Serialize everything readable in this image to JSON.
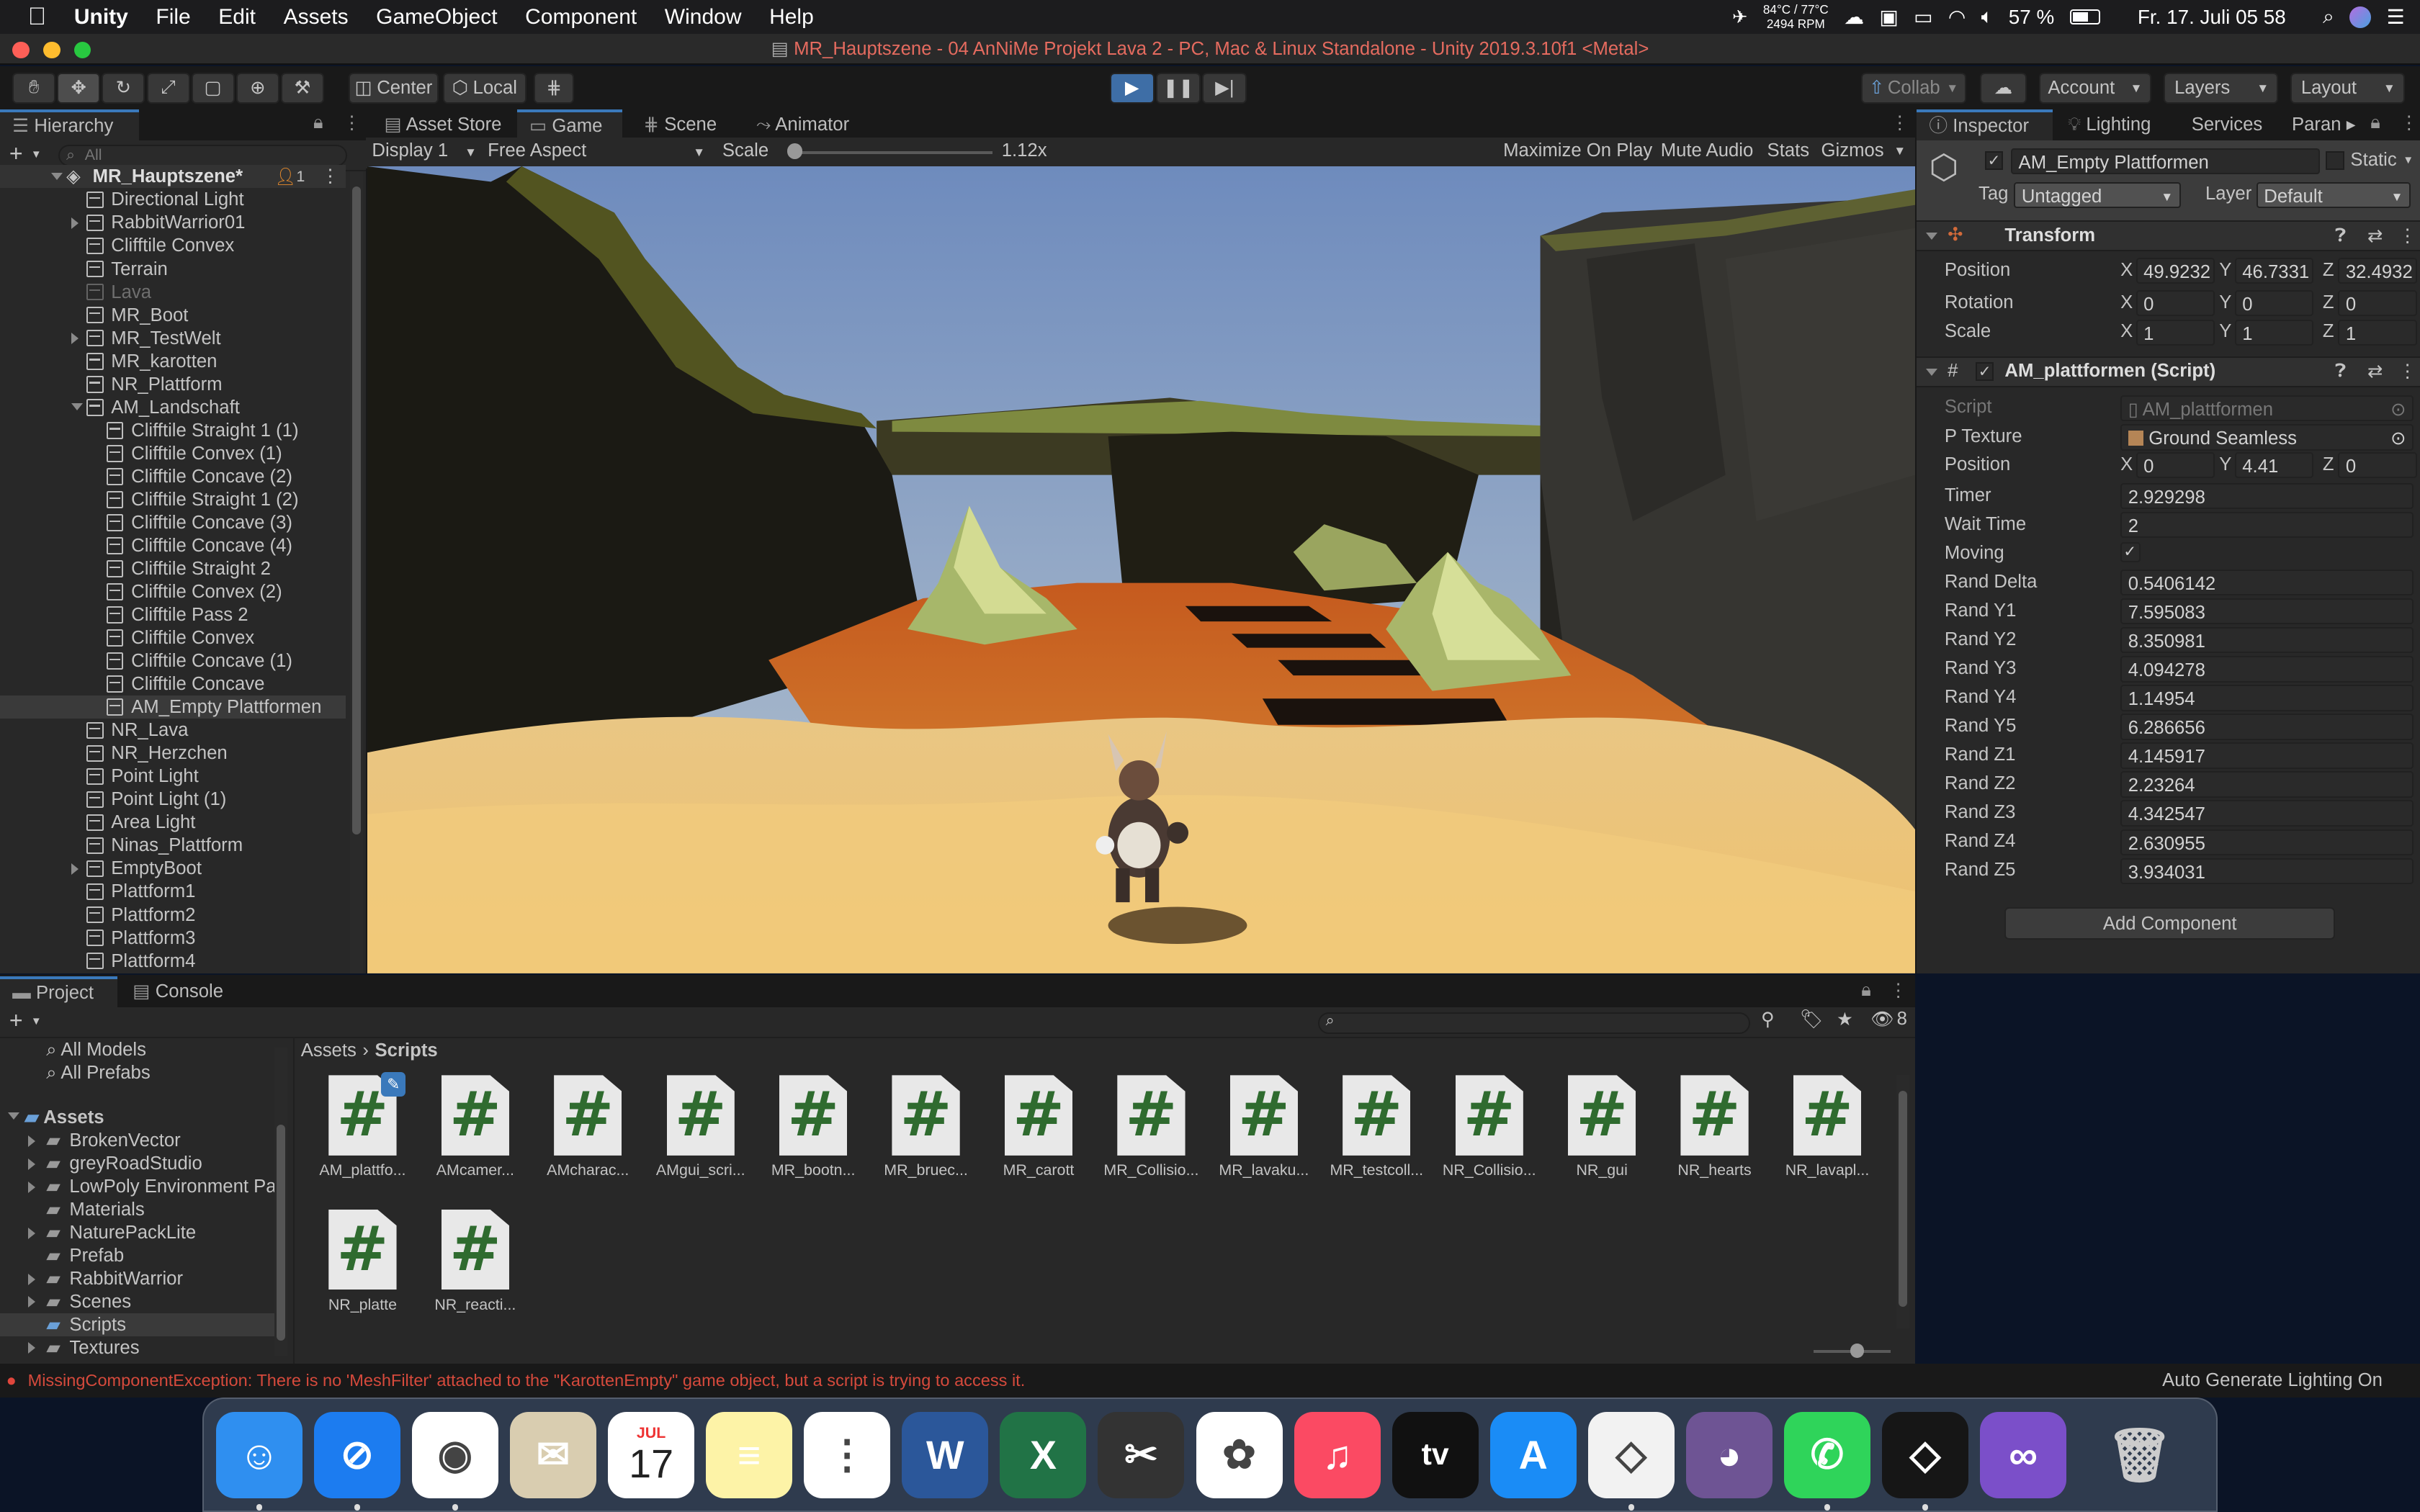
{
  "menubar": {
    "app": "Unity",
    "items": [
      "File",
      "Edit",
      "Assets",
      "GameObject",
      "Component",
      "Window",
      "Help"
    ],
    "temp": "84°C / 77°C",
    "rpm": "2494 RPM",
    "battery": "57 %",
    "datetime": "Fr. 17. Juli  05 58"
  },
  "window": {
    "title": "MR_Hauptszene - 04 AnNiMe Projekt Lava 2 - PC, Mac & Linux Standalone - Unity 2019.3.10f1 <Metal>"
  },
  "toolbar": {
    "center": "Center",
    "local": "Local",
    "collab": "Collab",
    "account": "Account",
    "layers": "Layers",
    "layout": "Layout"
  },
  "hierarchy": {
    "tab": "Hierarchy",
    "search_placeholder": "All",
    "scene": "MR_Hauptszene*",
    "scene_badge": "1",
    "items": [
      {
        "label": "Directional Light",
        "indent": 1,
        "expander": false,
        "dim": false,
        "selected": false
      },
      {
        "label": "RabbitWarrior01",
        "indent": 1,
        "expander": true,
        "dim": false,
        "selected": false
      },
      {
        "label": "Clifftile Convex",
        "indent": 1,
        "expander": false,
        "dim": false,
        "selected": false
      },
      {
        "label": "Terrain",
        "indent": 1,
        "expander": false,
        "dim": false,
        "selected": false
      },
      {
        "label": "Lava",
        "indent": 1,
        "expander": false,
        "dim": true,
        "selected": false
      },
      {
        "label": "MR_Boot",
        "indent": 1,
        "expander": false,
        "dim": false,
        "selected": false
      },
      {
        "label": "MR_TestWelt",
        "indent": 1,
        "expander": true,
        "dim": false,
        "selected": false
      },
      {
        "label": "MR_karotten",
        "indent": 1,
        "expander": false,
        "dim": false,
        "selected": false
      },
      {
        "label": "NR_Plattform",
        "indent": 1,
        "expander": false,
        "dim": false,
        "selected": false
      },
      {
        "label": "AM_Landschaft",
        "indent": 1,
        "expander": "open",
        "dim": false,
        "selected": false
      },
      {
        "label": "Clifftile Straight 1 (1)",
        "indent": 2,
        "expander": false,
        "dim": false,
        "selected": false
      },
      {
        "label": "Clifftile Convex (1)",
        "indent": 2,
        "expander": false,
        "dim": false,
        "selected": false
      },
      {
        "label": "Clifftile Concave (2)",
        "indent": 2,
        "expander": false,
        "dim": false,
        "selected": false
      },
      {
        "label": "Clifftile Straight 1 (2)",
        "indent": 2,
        "expander": false,
        "dim": false,
        "selected": false
      },
      {
        "label": "Clifftile Concave (3)",
        "indent": 2,
        "expander": false,
        "dim": false,
        "selected": false
      },
      {
        "label": "Clifftile Concave (4)",
        "indent": 2,
        "expander": false,
        "dim": false,
        "selected": false
      },
      {
        "label": "Clifftile Straight 2",
        "indent": 2,
        "expander": false,
        "dim": false,
        "selected": false
      },
      {
        "label": "Clifftile Convex (2)",
        "indent": 2,
        "expander": false,
        "dim": false,
        "selected": false
      },
      {
        "label": "Clifftile Pass 2",
        "indent": 2,
        "expander": false,
        "dim": false,
        "selected": false
      },
      {
        "label": "Clifftile Convex",
        "indent": 2,
        "expander": false,
        "dim": false,
        "selected": false
      },
      {
        "label": "Clifftile Concave (1)",
        "indent": 2,
        "expander": false,
        "dim": false,
        "selected": false
      },
      {
        "label": "Clifftile Concave",
        "indent": 2,
        "expander": false,
        "dim": false,
        "selected": false
      },
      {
        "label": "AM_Empty Plattformen",
        "indent": 2,
        "expander": false,
        "dim": false,
        "selected": true
      },
      {
        "label": "NR_Lava",
        "indent": 1,
        "expander": false,
        "dim": false,
        "selected": false
      },
      {
        "label": "NR_Herzchen",
        "indent": 1,
        "expander": false,
        "dim": false,
        "selected": false
      },
      {
        "label": "Point Light",
        "indent": 1,
        "expander": false,
        "dim": false,
        "selected": false
      },
      {
        "label": "Point Light (1)",
        "indent": 1,
        "expander": false,
        "dim": false,
        "selected": false
      },
      {
        "label": "Area Light",
        "indent": 1,
        "expander": false,
        "dim": false,
        "selected": false
      },
      {
        "label": "Ninas_Plattform",
        "indent": 1,
        "expander": false,
        "dim": false,
        "selected": false
      },
      {
        "label": "EmptyBoot",
        "indent": 1,
        "expander": true,
        "dim": false,
        "selected": false
      },
      {
        "label": "Plattform1",
        "indent": 1,
        "expander": false,
        "dim": false,
        "selected": false
      },
      {
        "label": "Plattform2",
        "indent": 1,
        "expander": false,
        "dim": false,
        "selected": false
      },
      {
        "label": "Plattform3",
        "indent": 1,
        "expander": false,
        "dim": false,
        "selected": false
      },
      {
        "label": "Plattform4",
        "indent": 1,
        "expander": false,
        "dim": false,
        "selected": false
      }
    ]
  },
  "center": {
    "tabs": [
      "Asset Store",
      "Game",
      "Scene",
      "Animator"
    ],
    "display": "Display 1",
    "aspect": "Free Aspect",
    "scale_label": "Scale",
    "scale_value": "1.12x",
    "maximize": "Maximize On Play",
    "mute": "Mute Audio",
    "stats": "Stats",
    "gizmos": "Gizmos"
  },
  "inspector": {
    "tabs": [
      "Inspector",
      "Lighting",
      "Services",
      "Paran"
    ],
    "object_name": "AM_Empty Plattformen",
    "static": "Static",
    "tag_label": "Tag",
    "tag": "Untagged",
    "layer_label": "Layer",
    "layer": "Default",
    "transform": {
      "title": "Transform",
      "position": {
        "label": "Position",
        "x": "49.9232",
        "y": "46.7331",
        "z": "32.4932"
      },
      "rotation": {
        "label": "Rotation",
        "x": "0",
        "y": "0",
        "z": "0"
      },
      "scale": {
        "label": "Scale",
        "x": "1",
        "y": "1",
        "z": "1"
      }
    },
    "script": {
      "title": "AM_plattformen (Script)",
      "script_label": "Script",
      "script_value": "AM_plattformen",
      "texture_label": "P Texture",
      "texture_value": "Ground Seamless",
      "position": {
        "label": "Position",
        "x": "0",
        "y": "4.41",
        "z": "0"
      },
      "fields": [
        {
          "label": "Timer",
          "value": "2.929298"
        },
        {
          "label": "Wait Time",
          "value": "2"
        },
        {
          "label": "Moving",
          "value": "✓"
        },
        {
          "label": "Rand Delta",
          "value": "0.5406142"
        },
        {
          "label": "Rand Y1",
          "value": "7.595083"
        },
        {
          "label": "Rand Y2",
          "value": "8.350981"
        },
        {
          "label": "Rand Y3",
          "value": "4.094278"
        },
        {
          "label": "Rand Y4",
          "value": "1.14954"
        },
        {
          "label": "Rand Y5",
          "value": "6.286656"
        },
        {
          "label": "Rand Z1",
          "value": "4.145917"
        },
        {
          "label": "Rand Z2",
          "value": "2.23264"
        },
        {
          "label": "Rand Z3",
          "value": "4.342547"
        },
        {
          "label": "Rand Z4",
          "value": "2.630955"
        },
        {
          "label": "Rand Z5",
          "value": "3.934031"
        }
      ]
    },
    "add_component": "Add Component"
  },
  "project": {
    "tabs": [
      "Project",
      "Console"
    ],
    "hidden_count": "8",
    "breadcrumb_root": "Assets",
    "breadcrumb_current": "Scripts",
    "favorites": [
      "All Models",
      "All Prefabs"
    ],
    "assets_root": "Assets",
    "folders": [
      {
        "label": "BrokenVector",
        "expander": true,
        "selected": false
      },
      {
        "label": "greyRoadStudio",
        "expander": true,
        "selected": false
      },
      {
        "label": "LowPoly Environment Pa",
        "expander": true,
        "selected": false
      },
      {
        "label": "Materials",
        "expander": false,
        "selected": false
      },
      {
        "label": "NaturePackLite",
        "expander": true,
        "selected": false
      },
      {
        "label": "Prefab",
        "expander": false,
        "selected": false
      },
      {
        "label": "RabbitWarrior",
        "expander": true,
        "selected": false
      },
      {
        "label": "Scenes",
        "expander": true,
        "selected": false
      },
      {
        "label": "Scripts",
        "expander": false,
        "selected": true
      },
      {
        "label": "Textures",
        "expander": true,
        "selected": false
      }
    ],
    "scripts": [
      "AM_plattfo...",
      "AMcamer...",
      "AMcharac...",
      "AMgui_scri...",
      "MR_bootn...",
      "MR_bruec...",
      "MR_carott",
      "MR_Collisio...",
      "MR_lavaku...",
      "MR_testcoll...",
      "NR_Collisio...",
      "NR_gui",
      "NR_hearts",
      "NR_lavapl...",
      "NR_platte",
      "NR_reacti..."
    ]
  },
  "status": {
    "error": "MissingComponentException: There is no 'MeshFilter' attached to the \"KarottenEmpty\" game object, but a script is trying to access it.",
    "right": "Auto Generate Lighting On"
  },
  "dock": {
    "calendar_month": "JUL",
    "calendar_day": "17",
    "tv": "tv",
    "apps": [
      {
        "icon": "finder-icon",
        "bg": "#2f8ff0",
        "running": true
      },
      {
        "icon": "safari-icon",
        "bg": "#1c7cf0",
        "running": true
      },
      {
        "icon": "chrome-icon",
        "bg": "#ffffff",
        "running": true
      },
      {
        "icon": "mail-icon",
        "bg": "#d9cdb0",
        "running": false
      },
      {
        "icon": "calendar-icon",
        "bg": "#ffffff",
        "running": false
      },
      {
        "icon": "notes-icon",
        "bg": "#fdf3a7",
        "running": false
      },
      {
        "icon": "reminders-icon",
        "bg": "#ffffff",
        "running": false
      },
      {
        "icon": "word-icon",
        "bg": "#2b579a",
        "running": false
      },
      {
        "icon": "excel-icon",
        "bg": "#217346",
        "running": false
      },
      {
        "icon": "finalcut-icon",
        "bg": "#333333",
        "running": false
      },
      {
        "icon": "photos-icon",
        "bg": "#ffffff",
        "running": false
      },
      {
        "icon": "music-icon",
        "bg": "#fb4a63",
        "running": false
      },
      {
        "icon": "appletv-icon",
        "bg": "#111111",
        "running": false
      },
      {
        "icon": "appstore-icon",
        "bg": "#1a8cf6",
        "running": false
      },
      {
        "icon": "unity-hub-icon",
        "bg": "#f2f2f2",
        "running": true
      },
      {
        "icon": "github-icon",
        "bg": "#6e5494",
        "running": false
      },
      {
        "icon": "whatsapp-icon",
        "bg": "#2fd45a",
        "running": true
      },
      {
        "icon": "unity-icon",
        "bg": "#161616",
        "running": true
      },
      {
        "icon": "visualstudio-icon",
        "bg": "#7b4fc9",
        "running": false
      },
      {
        "icon": "trash-icon",
        "bg": "transparent",
        "running": false
      }
    ]
  }
}
